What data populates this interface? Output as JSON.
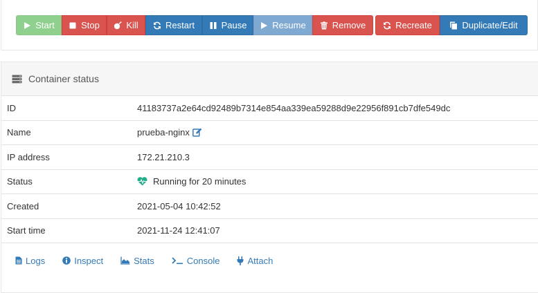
{
  "toolbar": {
    "start_label": "Start",
    "stop_label": "Stop",
    "kill_label": "Kill",
    "restart_label": "Restart",
    "pause_label": "Pause",
    "resume_label": "Resume",
    "remove_label": "Remove",
    "recreate_label": "Recreate",
    "duplicate_label": "Duplicate/Edit"
  },
  "widget": {
    "title": "Container status",
    "rows": [
      {
        "label": "ID",
        "value": "41183737a2e64cd92489b7314e854aa339ea59288d9e22956f891cb7dfe549dc"
      },
      {
        "label": "Name",
        "value": "prueba-nginx"
      },
      {
        "label": "IP address",
        "value": "172.21.210.3"
      },
      {
        "label": "Status",
        "value": "Running for 20 minutes"
      },
      {
        "label": "Created",
        "value": "2021-05-04 10:42:52"
      },
      {
        "label": "Start time",
        "value": "2021-11-24 12:41:07"
      }
    ],
    "links": {
      "logs": "Logs",
      "inspect": "Inspect",
      "stats": "Stats",
      "console": "Console",
      "attach": "Attach"
    }
  },
  "colors": {
    "success_disabled": "#8fd08f",
    "danger": "#d9534f",
    "primary": "#337ab7",
    "primary_disabled": "#7fa9d1",
    "running": "#23ae89",
    "link": "#337ab7"
  },
  "icons": {
    "start": "play-icon",
    "stop": "stop-icon",
    "kill": "bomb-icon",
    "restart": "refresh-icon",
    "pause": "pause-icon",
    "resume": "play-icon",
    "remove": "trash-icon",
    "recreate": "refresh-icon",
    "duplicate": "copy-icon",
    "header": "server-icon",
    "name_edit": "edit-icon",
    "status": "heartbeat-icon",
    "logs": "file-text-icon",
    "inspect": "info-circle-icon",
    "stats": "area-chart-icon",
    "console": "terminal-icon",
    "attach": "plug-icon"
  }
}
